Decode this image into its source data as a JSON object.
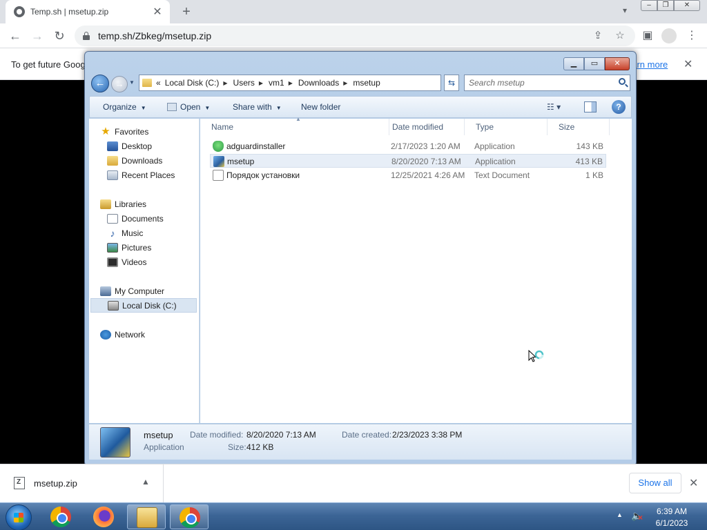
{
  "browser": {
    "tab_title": "Temp.sh | msetup.zip",
    "tab_close": "✕",
    "new_tab": "+",
    "url": "temp.sh/Zbkeg/msetup.zip",
    "icons": [
      "back-icon",
      "forward-icon",
      "reload-icon",
      "lock-icon",
      "share-icon",
      "star-icon",
      "side-panel-icon",
      "profile-icon",
      "menu-icon"
    ]
  },
  "info_bar": {
    "text": "To get future Goog",
    "link": "earn more",
    "close": "✕"
  },
  "explorer": {
    "breadcrumbs": [
      "Local Disk (C:)",
      "Users",
      "vm1",
      "Downloads",
      "msetup"
    ],
    "breadcrumb_prefix": "«",
    "search_placeholder": "Search msetup",
    "commands": {
      "organize": "Organize",
      "open": "Open",
      "share_with": "Share with",
      "new_folder": "New folder"
    },
    "nav": {
      "favorites": "Favorites",
      "desktop": "Desktop",
      "downloads": "Downloads",
      "recent_places": "Recent Places",
      "libraries": "Libraries",
      "documents": "Documents",
      "music": "Music",
      "pictures": "Pictures",
      "videos": "Videos",
      "my_computer": "My Computer",
      "local_disk": "Local Disk (C:)",
      "network": "Network"
    },
    "columns": {
      "name": "Name",
      "date_modified": "Date modified",
      "type": "Type",
      "size": "Size"
    },
    "files": [
      {
        "name": "adguardinstaller",
        "date": "2/17/2023 1:20 AM",
        "type": "Application",
        "size": "143 KB",
        "icon": "adguard-shield-icon"
      },
      {
        "name": "msetup",
        "date": "8/20/2020 7:13 AM",
        "type": "Application",
        "size": "413 KB",
        "icon": "setup-installer-icon",
        "selected": true
      },
      {
        "name": "Порядок установки",
        "date": "12/25/2021 4:26 AM",
        "type": "Text Document",
        "size": "1 KB",
        "icon": "text-document-icon"
      }
    ],
    "details": {
      "name": "msetup",
      "kind": "Application",
      "date_modified_label": "Date modified:",
      "date_modified": "8/20/2020 7:13 AM",
      "size_label": "Size:",
      "size": "412 KB",
      "date_created_label": "Date created:",
      "date_created": "2/23/2023 3:38 PM"
    }
  },
  "download_bar": {
    "file": "msetup.zip",
    "show_all": "Show all"
  },
  "taskbar": {
    "time": "6:39 AM",
    "date": "6/1/2023"
  }
}
